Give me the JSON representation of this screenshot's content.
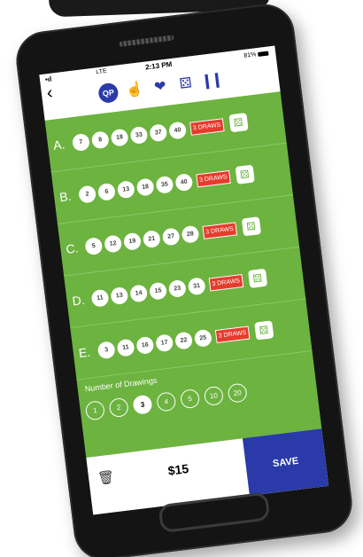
{
  "status": {
    "signal": "•ıl",
    "network": "LTE",
    "time": "2:13 PM",
    "battery": "81%"
  },
  "header": {
    "back_icon": "chevron-left-icon",
    "qp_label": "QP",
    "icons": [
      "hand-pointer-icon",
      "heart-icon",
      "dice-icon",
      "bar-chart-icon"
    ]
  },
  "rows": [
    {
      "label": "A.",
      "numbers": [
        "7",
        "8",
        "18",
        "33",
        "37",
        "40"
      ],
      "draws": "3 DRAWS"
    },
    {
      "label": "B.",
      "numbers": [
        "2",
        "6",
        "13",
        "18",
        "35",
        "40"
      ],
      "draws": "3 DRAWS"
    },
    {
      "label": "C.",
      "numbers": [
        "5",
        "12",
        "19",
        "21",
        "27",
        "28"
      ],
      "draws": "3 DRAWS"
    },
    {
      "label": "D.",
      "numbers": [
        "11",
        "13",
        "14",
        "15",
        "23",
        "31"
      ],
      "draws": "3 DRAWS"
    },
    {
      "label": "E.",
      "numbers": [
        "3",
        "11",
        "16",
        "17",
        "22",
        "25"
      ],
      "draws": "3 DRAWS"
    }
  ],
  "drawings": {
    "label": "Number of Drawings",
    "options": [
      "1",
      "2",
      "3",
      "4",
      "5",
      "10",
      "20"
    ],
    "selected": "3"
  },
  "footer": {
    "price": "$15",
    "save": "SAVE"
  },
  "colors": {
    "green": "#6cb33f",
    "blue": "#2a3aa8",
    "red": "#e53b2c"
  }
}
